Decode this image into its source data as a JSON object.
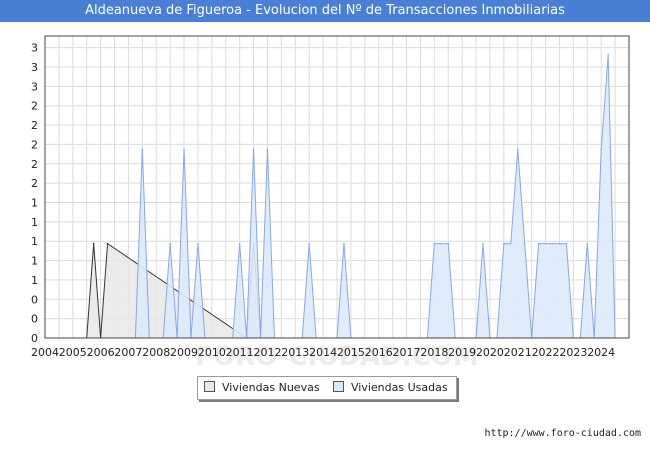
{
  "header": {
    "title": "Aldeanueva de Figueroa - Evolucion del Nº de Transacciones Inmobiliarias"
  },
  "footer": {
    "source": "http://www.foro-ciudad.com"
  },
  "watermark": "FORO-CIUDAD.COM",
  "chart_data": {
    "type": "area",
    "title": "Aldeanueva de Figueroa - Evolucion del Nº de Transacciones Inmobiliarias",
    "xlabel": "",
    "ylabel": "",
    "x_range": [
      2004.0,
      2025.0
    ],
    "ylim": [
      0,
      3.2
    ],
    "x_tick_labels": [
      "2004",
      "2005",
      "2006",
      "2007",
      "2008",
      "2009",
      "2010",
      "2011",
      "2012",
      "2013",
      "2014",
      "2015",
      "2016",
      "2017",
      "2018",
      "2019",
      "2020",
      "2021",
      "2022",
      "2023",
      "2024"
    ],
    "y_tick_labels": [
      "0",
      "0",
      "0",
      "1",
      "1",
      "1",
      "1",
      "1",
      "2",
      "2",
      "2",
      "2",
      "2",
      "3",
      "3",
      "3"
    ],
    "grid": true,
    "legend_position": "bottom",
    "series": [
      {
        "name": "Viviendas Nuevas",
        "color": "#e8e8e8",
        "line_color": "#333333",
        "x": [
          2005.5,
          2005.75,
          2006.0,
          2006.25,
          2011.25,
          2011.5,
          2011.75
        ],
        "y": [
          0,
          1,
          0,
          1,
          0,
          1,
          0
        ]
      },
      {
        "name": "Viviendas Usadas",
        "color": "#dbeafb",
        "line_color": "#8aa6e6",
        "x": [
          2007.25,
          2007.5,
          2007.75,
          2008.25,
          2008.5,
          2008.75,
          2008.75,
          2009.0,
          2009.25,
          2009.25,
          2009.5,
          2009.75,
          2010.75,
          2011.0,
          2011.25,
          2011.25,
          2011.5,
          2011.75,
          2011.75,
          2012.0,
          2012.25,
          2013.25,
          2013.5,
          2013.75,
          2014.5,
          2014.75,
          2015.0,
          2017.75,
          2018.0,
          2018.25,
          2018.5,
          2018.75,
          2019.5,
          2019.75,
          2020.0,
          2020.25,
          2020.5,
          2020.75,
          2021.0,
          2021.25,
          2021.5,
          2021.75,
          2022.0,
          2022.25,
          2022.5,
          2022.75,
          2023.0,
          2023.25,
          2023.5,
          2023.75,
          2024.0,
          2024.25,
          2024.5
        ],
        "y": [
          0,
          2,
          0,
          0,
          1,
          0,
          0,
          2,
          0,
          0,
          1,
          0,
          0,
          1,
          0,
          0,
          2,
          0,
          0,
          2,
          0,
          0,
          1,
          0,
          0,
          1,
          0,
          0,
          1,
          1,
          1,
          0,
          0,
          1,
          0,
          0,
          1,
          1,
          2,
          1,
          0,
          1,
          1,
          1,
          1,
          1,
          0,
          0,
          1,
          0,
          2,
          3,
          0
        ]
      }
    ]
  }
}
